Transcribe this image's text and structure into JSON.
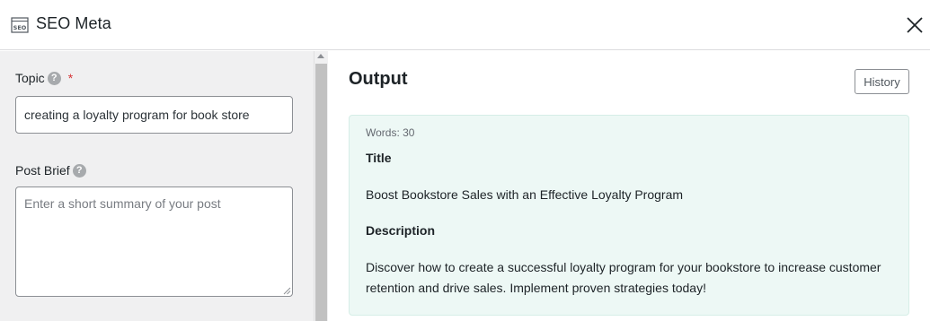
{
  "header": {
    "title": "SEO Meta",
    "icon": "seo-icon",
    "close_icon": "close-icon"
  },
  "form": {
    "topic": {
      "label": "Topic",
      "required_mark": "*",
      "value": "creating a loyalty program for book store"
    },
    "post_brief": {
      "label": "Post Brief",
      "placeholder": "Enter a short summary of your post",
      "value": ""
    },
    "help_glyph": "?"
  },
  "output": {
    "title": "Output",
    "history_label": "History",
    "words": "Words: 30",
    "title_heading": "Title",
    "title_text": "Boost Bookstore Sales with an Effective Loyalty Program",
    "description_heading": "Description",
    "description_text": "Discover how to create a successful loyalty program for your bookstore to increase customer retention and drive sales. Implement proven strategies today!"
  },
  "colors": {
    "output_bg": "#edf8f5",
    "required": "#d63638",
    "panel_bg": "#f0f0f1"
  }
}
